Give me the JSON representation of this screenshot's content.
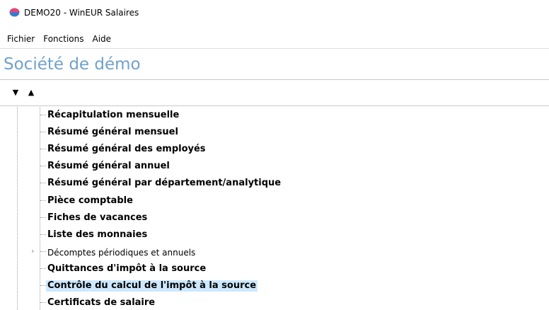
{
  "window": {
    "title": "DEMO20 - WinEUR Salaires",
    "icon": "app-icon"
  },
  "menubar": {
    "items": [
      "Fichier",
      "Fonctions",
      "Aide"
    ]
  },
  "company": {
    "name": "Société de démo"
  },
  "sort": {
    "down_glyph": "▼",
    "up_glyph": "▲"
  },
  "tree": {
    "items": [
      {
        "label": "Récapitulation mensuelle",
        "bold": true
      },
      {
        "label": "Résumé général mensuel",
        "bold": true
      },
      {
        "label": "Résumé général des employés",
        "bold": true
      },
      {
        "label": "Résumé général annuel",
        "bold": true
      },
      {
        "label": "Résumé général par département/analytique",
        "bold": true
      },
      {
        "label": "Pièce comptable",
        "bold": true
      },
      {
        "label": "Fiches de vacances",
        "bold": true
      },
      {
        "label": "Liste des monnaies",
        "bold": true
      },
      {
        "label": "Décomptes périodiques et annuels",
        "bold": false,
        "expandable": true
      },
      {
        "label": "Quittances d'impôt à la source",
        "bold": true
      },
      {
        "label": "Contrôle du calcul de l'impôt à la source",
        "bold": true,
        "selected": true
      },
      {
        "label": "Certificats de salaire",
        "bold": true
      }
    ],
    "expander_glyph": "›"
  },
  "colors": {
    "company_text": "#6fa2cc",
    "selection": "#cce8ff",
    "icon_top": "#e0457b",
    "icon_bottom": "#2f7fd0"
  }
}
